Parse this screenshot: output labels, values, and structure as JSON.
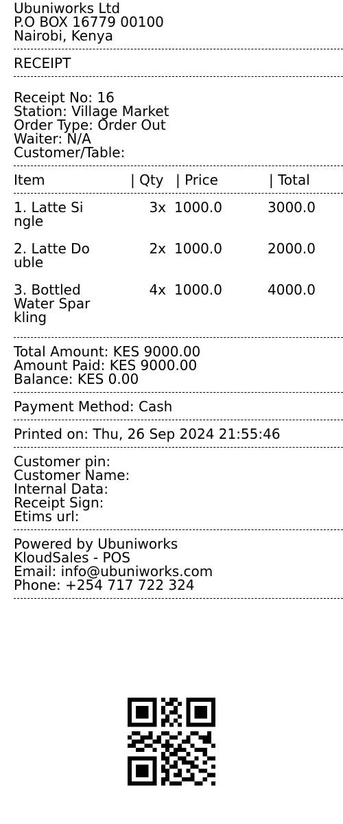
{
  "company": {
    "name": "Ubuniworks Ltd",
    "address": "P.O BOX 16779 00100",
    "city": "Nairobi, Kenya"
  },
  "title": "RECEIPT",
  "details": {
    "receipt_no": "Receipt No: 16",
    "station": "Station: Village Market",
    "order_type": "Order Type: Order Out",
    "waiter": "Waiter: N/A",
    "customer_table": "Customer/Table:"
  },
  "table": {
    "headers": {
      "item": "Item",
      "qty": "| Qty",
      "price": "| Price",
      "total": "| Total"
    },
    "rows": [
      {
        "name": "1. Latte Single",
        "qty": "3x",
        "price": "1000.0",
        "total": "3000.0"
      },
      {
        "name": "2. Latte Double",
        "qty": "2x",
        "price": "1000.0",
        "total": "2000.0"
      },
      {
        "name": "3. Bottled Water Sparkling",
        "qty": "4x",
        "price": "1000.0",
        "total": "4000.0"
      }
    ]
  },
  "totals": {
    "total_amount": "Total Amount: KES 9000.00",
    "amount_paid": "Amount Paid: KES 9000.00",
    "balance": "Balance: KES 0.00"
  },
  "payment_method": "Payment Method: Cash",
  "printed_on": "Printed on: Thu, 26 Sep 2024 21:55:46",
  "tax_info": {
    "customer_pin": "Customer pin:",
    "customer_name": "Customer Name:",
    "internal_data": "Internal Data:",
    "receipt_sign": "Receipt Sign:",
    "etims_url": "Etims url:"
  },
  "footer": {
    "powered_by": "Powered by Ubuniworks",
    "product": "KloudSales - POS",
    "email": "Email: info@ubuniworks.com",
    "phone": "Phone: +254 717 722 324"
  }
}
